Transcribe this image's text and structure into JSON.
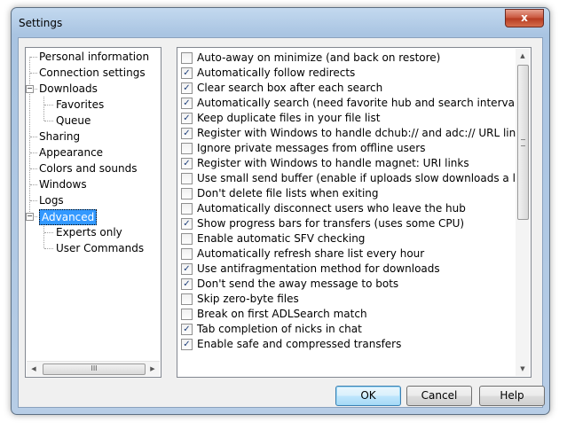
{
  "window": {
    "title": "Settings",
    "close_label": "x"
  },
  "tree": {
    "items": [
      {
        "label": "Personal information"
      },
      {
        "label": "Connection settings"
      },
      {
        "label": "Downloads"
      },
      {
        "label": "Favorites"
      },
      {
        "label": "Queue"
      },
      {
        "label": "Sharing"
      },
      {
        "label": "Appearance"
      },
      {
        "label": "Colors and sounds"
      },
      {
        "label": "Windows"
      },
      {
        "label": "Logs"
      },
      {
        "label": "Advanced",
        "selected": true
      },
      {
        "label": "Experts only"
      },
      {
        "label": "User Commands"
      }
    ],
    "expander_glyph": "−",
    "scroll_grip": "III"
  },
  "options": [
    {
      "label": "Auto-away on minimize (and back on restore)",
      "checked": false
    },
    {
      "label": "Automatically follow redirects",
      "checked": true
    },
    {
      "label": "Clear search box after each search",
      "checked": true
    },
    {
      "label": "Automatically search (need favorite hub and search interval)",
      "checked": true
    },
    {
      "label": "Keep duplicate files in your file list",
      "checked": true
    },
    {
      "label": "Register with Windows to handle dchub:// and adc:// URL links",
      "checked": true
    },
    {
      "label": "Ignore private messages from offline users",
      "checked": false
    },
    {
      "label": "Register with Windows to handle magnet: URI links",
      "checked": true
    },
    {
      "label": "Use small send buffer (enable if uploads slow downloads a lot)",
      "checked": false
    },
    {
      "label": "Don't delete file lists when exiting",
      "checked": false
    },
    {
      "label": "Automatically disconnect users who leave the hub",
      "checked": false
    },
    {
      "label": "Show progress bars for transfers (uses some CPU)",
      "checked": true
    },
    {
      "label": "Enable automatic SFV checking",
      "checked": false
    },
    {
      "label": "Automatically refresh share list every hour",
      "checked": false
    },
    {
      "label": "Use antifragmentation method for downloads",
      "checked": true
    },
    {
      "label": "Don't send the away message to bots",
      "checked": true
    },
    {
      "label": "Skip zero-byte files",
      "checked": false
    },
    {
      "label": "Break on first ADLSearch match",
      "checked": false
    },
    {
      "label": "Tab completion of nicks in chat",
      "checked": true
    },
    {
      "label": "Enable safe and compressed transfers",
      "checked": true
    }
  ],
  "checkmark_glyph": "✓",
  "buttons": {
    "ok": "OK",
    "cancel": "Cancel",
    "help": "Help"
  },
  "icons": {
    "up": "▲",
    "down": "▼",
    "left": "◀",
    "right": "▶"
  }
}
